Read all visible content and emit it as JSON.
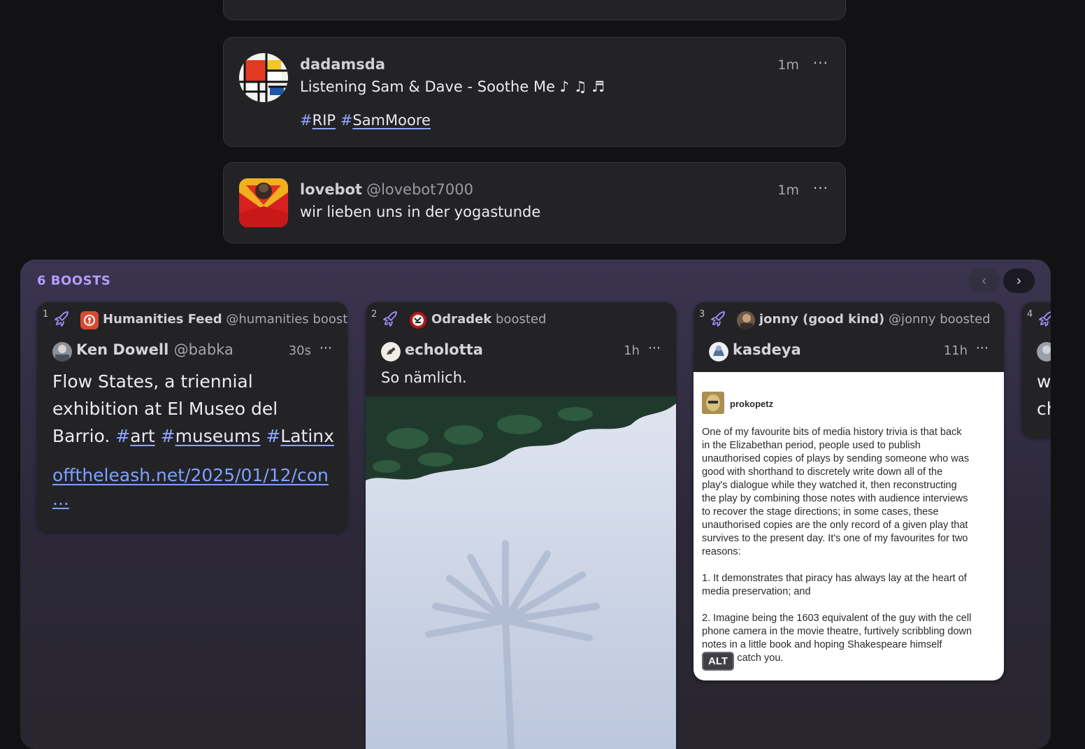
{
  "posts": [
    {
      "name": "dadamsda",
      "handle": "",
      "time": "1m",
      "text": "Listening Sam & Dave - Soothe Me ♪ ♫ ♬",
      "tags": [
        "RIP",
        "SamMoore"
      ]
    },
    {
      "name": "lovebot",
      "handle": "@lovebot7000",
      "time": "1m",
      "text": "wir lieben uns in der yogastunde"
    }
  ],
  "more_label": "···",
  "boosts": {
    "title": "6 BOOSTS",
    "prev_icon": "‹",
    "next_icon": "›",
    "boosted_word": "boosted",
    "cards": [
      {
        "index": "1",
        "booster_name": "Humanities Feed",
        "booster_handle": "@humanities",
        "author_name": "Ken Dowell",
        "author_handle": "@babka",
        "time": "30s",
        "text_lines": [
          "Flow States, a triennial",
          "exhibition at El Museo del",
          "Barrio."
        ],
        "tags": [
          "art",
          "museums",
          "Latinx"
        ],
        "link": "offtheleash.net/2025/01/12/con",
        "link_more": "..."
      },
      {
        "index": "2",
        "booster_name": "Odradek",
        "booster_handle": "",
        "author_name": "echolotta",
        "author_handle": "",
        "time": "1h",
        "text": "So nämlich."
      },
      {
        "index": "3",
        "booster_name": "jonny (good kind)",
        "booster_handle": "@jonny",
        "author_name": "kasdeya",
        "author_handle": "",
        "time": "11h",
        "image": {
          "username": "prokopetz",
          "para1": [
            "One of my favourite bits of media history trivia is that back",
            "in the Elizabethan period, people used to publish",
            "unauthorised copies of plays by sending someone who was",
            "good with shorthand to discretely write down all of the",
            "play's dialogue while they watched it, then reconstructing",
            "the play by combining those notes with audience interviews",
            "to recover the stage directions; in some cases, these",
            "unauthorised copies are the only record of a given play that",
            "survives to the present day. It's one of my favourites for two",
            "reasons:"
          ],
          "para2": [
            "1. It demonstrates that piracy has always lay at the heart of",
            "media preservation; and"
          ],
          "para3": [
            "2. Imagine being the 1603 equivalent of the guy with the cell",
            "phone camera in the movie theatre, furtively scribbling down",
            "notes in a little book and hoping Shakespeare himself",
            "doesn't catch you."
          ],
          "alt_label": "ALT"
        }
      },
      {
        "index": "4",
        "text_lines": [
          "w",
          "ch"
        ]
      }
    ]
  }
}
